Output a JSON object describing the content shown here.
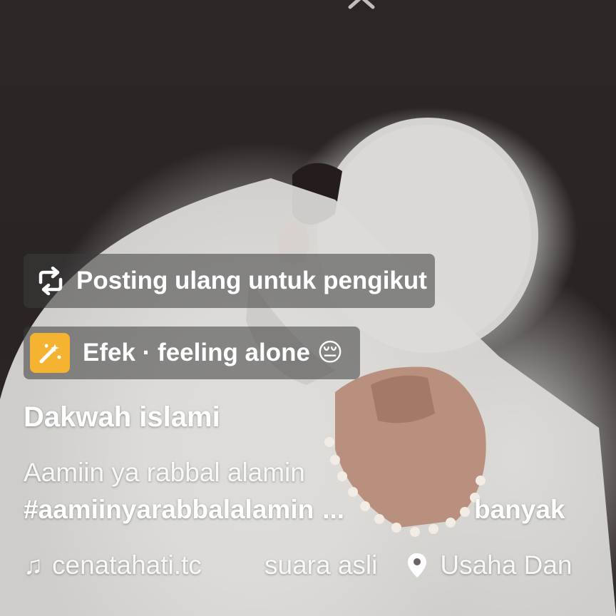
{
  "repost": {
    "label": "Posting ulang untuk pengikut",
    "icon": "repost-icon"
  },
  "effect": {
    "label": "Efek · feeling alone 😔",
    "icon": "effect-sparkle-icon",
    "thumb_color": "#f4b431"
  },
  "post": {
    "author": "Dakwah islami",
    "caption_line1": "Aamiin ya rabbal alamin",
    "hashtag": "#aamiinyarabbalalamin",
    "ellipsis": "...",
    "more_label": "banyak"
  },
  "sound": {
    "icon": "music-note-icon",
    "user": "cenatahati.tc",
    "title": "suara asli"
  },
  "location": {
    "icon": "location-pin-icon",
    "label": "Usaha Dan"
  }
}
